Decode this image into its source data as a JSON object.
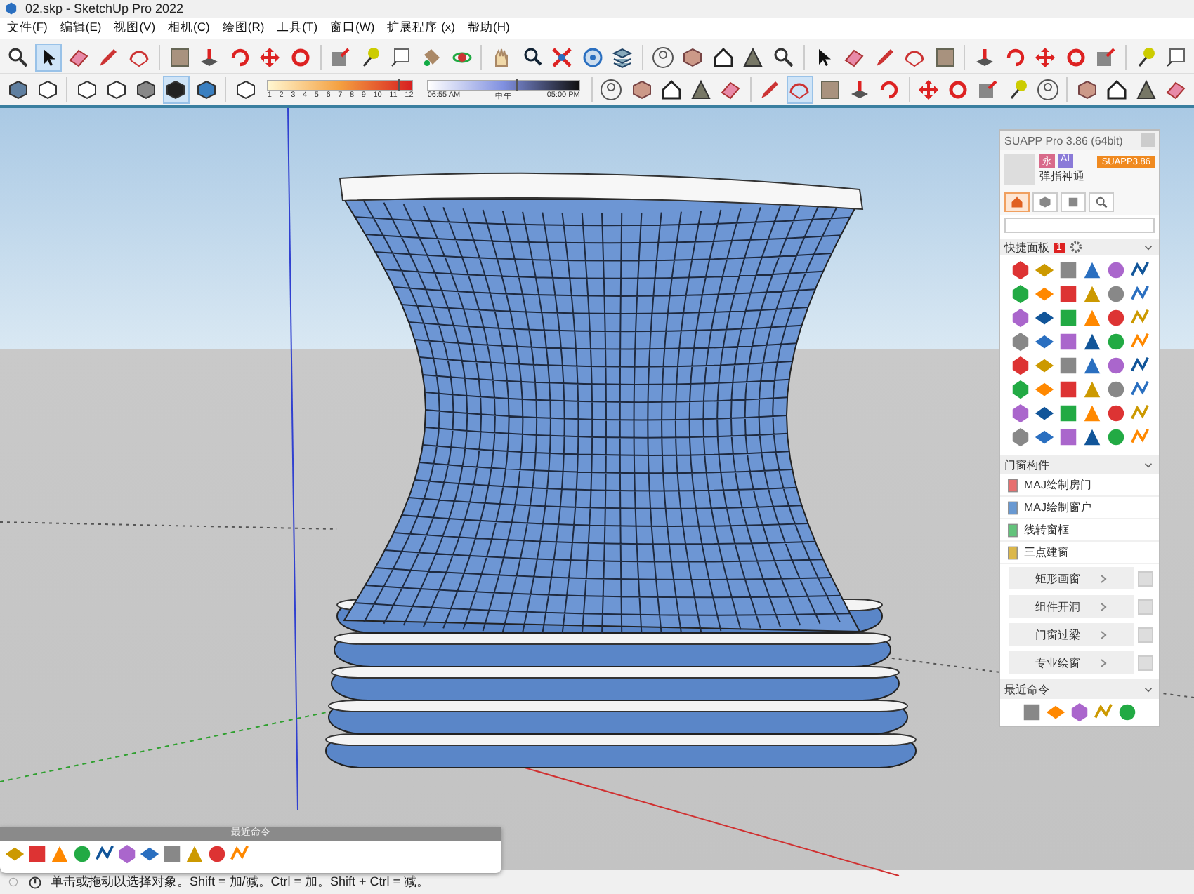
{
  "window": {
    "title": "02.skp - SketchUp Pro 2022"
  },
  "menu": [
    "文件(F)",
    "编辑(E)",
    "视图(V)",
    "相机(C)",
    "绘图(R)",
    "工具(T)",
    "窗口(W)",
    "扩展程序 (x)",
    "帮助(H)"
  ],
  "toolbar_1": {
    "tools": [
      {
        "selected": false
      },
      {
        "selected": true
      },
      {
        "selected": false
      },
      {
        "selected": false
      },
      {
        "selected": false
      },
      {
        "selected": false
      },
      {
        "selected": false
      },
      {
        "selected": false
      },
      {
        "selected": false
      },
      {
        "selected": false
      },
      {
        "selected": false
      },
      {
        "selected": false
      },
      {
        "selected": false
      },
      {
        "selected": false
      },
      {
        "selected": false
      },
      {
        "selected": false
      },
      {
        "selected": false
      },
      {
        "selected": false
      },
      {
        "selected": false
      },
      {
        "selected": false
      },
      {
        "selected": false
      },
      {
        "selected": false
      },
      {
        "selected": false
      },
      {
        "selected": false
      },
      {
        "selected": false
      },
      {
        "selected": false
      },
      {
        "selected": false
      },
      {
        "selected": false
      },
      {
        "selected": false
      },
      {
        "selected": false
      },
      {
        "selected": false
      },
      {
        "selected": false
      },
      {
        "selected": false
      },
      {
        "selected": false
      },
      {
        "selected": false
      },
      {
        "selected": false
      },
      {
        "selected": false
      }
    ]
  },
  "toolbar_2": {
    "styles": [
      {
        "selected": false
      },
      {
        "selected": false
      },
      {
        "selected": false
      },
      {
        "selected": false
      },
      {
        "selected": false
      },
      {
        "selected": true
      },
      {
        "selected": false
      },
      {
        "selected": false
      }
    ],
    "shadow": {
      "months": [
        "1",
        "2",
        "3",
        "4",
        "5",
        "6",
        "7",
        "8",
        "9",
        "10",
        "11",
        "12"
      ],
      "month_slider": {
        "level": 0.9
      },
      "time_start": "06:55 AM",
      "time_mid": "中午",
      "time_end": "05:00 PM",
      "time_slider": {
        "level": 0.58
      }
    },
    "tools": [
      {
        "selected": false
      },
      {
        "selected": false
      },
      {
        "selected": false
      },
      {
        "selected": false
      },
      {
        "selected": false
      },
      {
        "selected": false
      },
      {
        "selected": true
      },
      {
        "selected": false
      },
      {
        "selected": false
      },
      {
        "selected": false
      },
      {
        "selected": false
      },
      {
        "selected": false
      },
      {
        "selected": false
      },
      {
        "selected": false
      },
      {
        "selected": false
      },
      {
        "selected": false
      },
      {
        "selected": false
      },
      {
        "selected": false
      },
      {
        "selected": false
      }
    ]
  },
  "suapp_panel": {
    "title": "SUAPP Pro 3.86 (64bit)",
    "badges": [
      "永",
      "AI"
    ],
    "user_name": "弹指神通",
    "version_button": "SUAPP3.86",
    "tabs": [
      {
        "selected": true
      },
      {
        "selected": false
      },
      {
        "selected": false
      },
      {
        "selected": false
      }
    ],
    "quick_panel": {
      "title": "快捷面板",
      "badge": "1",
      "expanded": true
    },
    "sections": [
      {
        "title": "门窗构件",
        "expanded": true,
        "items": [
          {
            "kind": "command",
            "label": "MAJ绘制房门"
          },
          {
            "kind": "command",
            "label": "MAJ绘制窗户"
          },
          {
            "kind": "command",
            "label": "线转窗框"
          },
          {
            "kind": "command",
            "label": "三点建窗"
          },
          {
            "kind": "submenu",
            "label": "矩形画窗"
          },
          {
            "kind": "submenu",
            "label": "组件开洞"
          },
          {
            "kind": "submenu",
            "label": "门窗过梁"
          },
          {
            "kind": "submenu",
            "label": "专业绘窗"
          }
        ]
      },
      {
        "title": "最近命令",
        "expanded": true
      }
    ]
  },
  "recent_palette": {
    "title": "最近命令"
  },
  "status_bar": {
    "text": "单击或拖动以选择对象。Shift = 加/减。Ctrl = 加。Shift + Ctrl = 减。"
  }
}
